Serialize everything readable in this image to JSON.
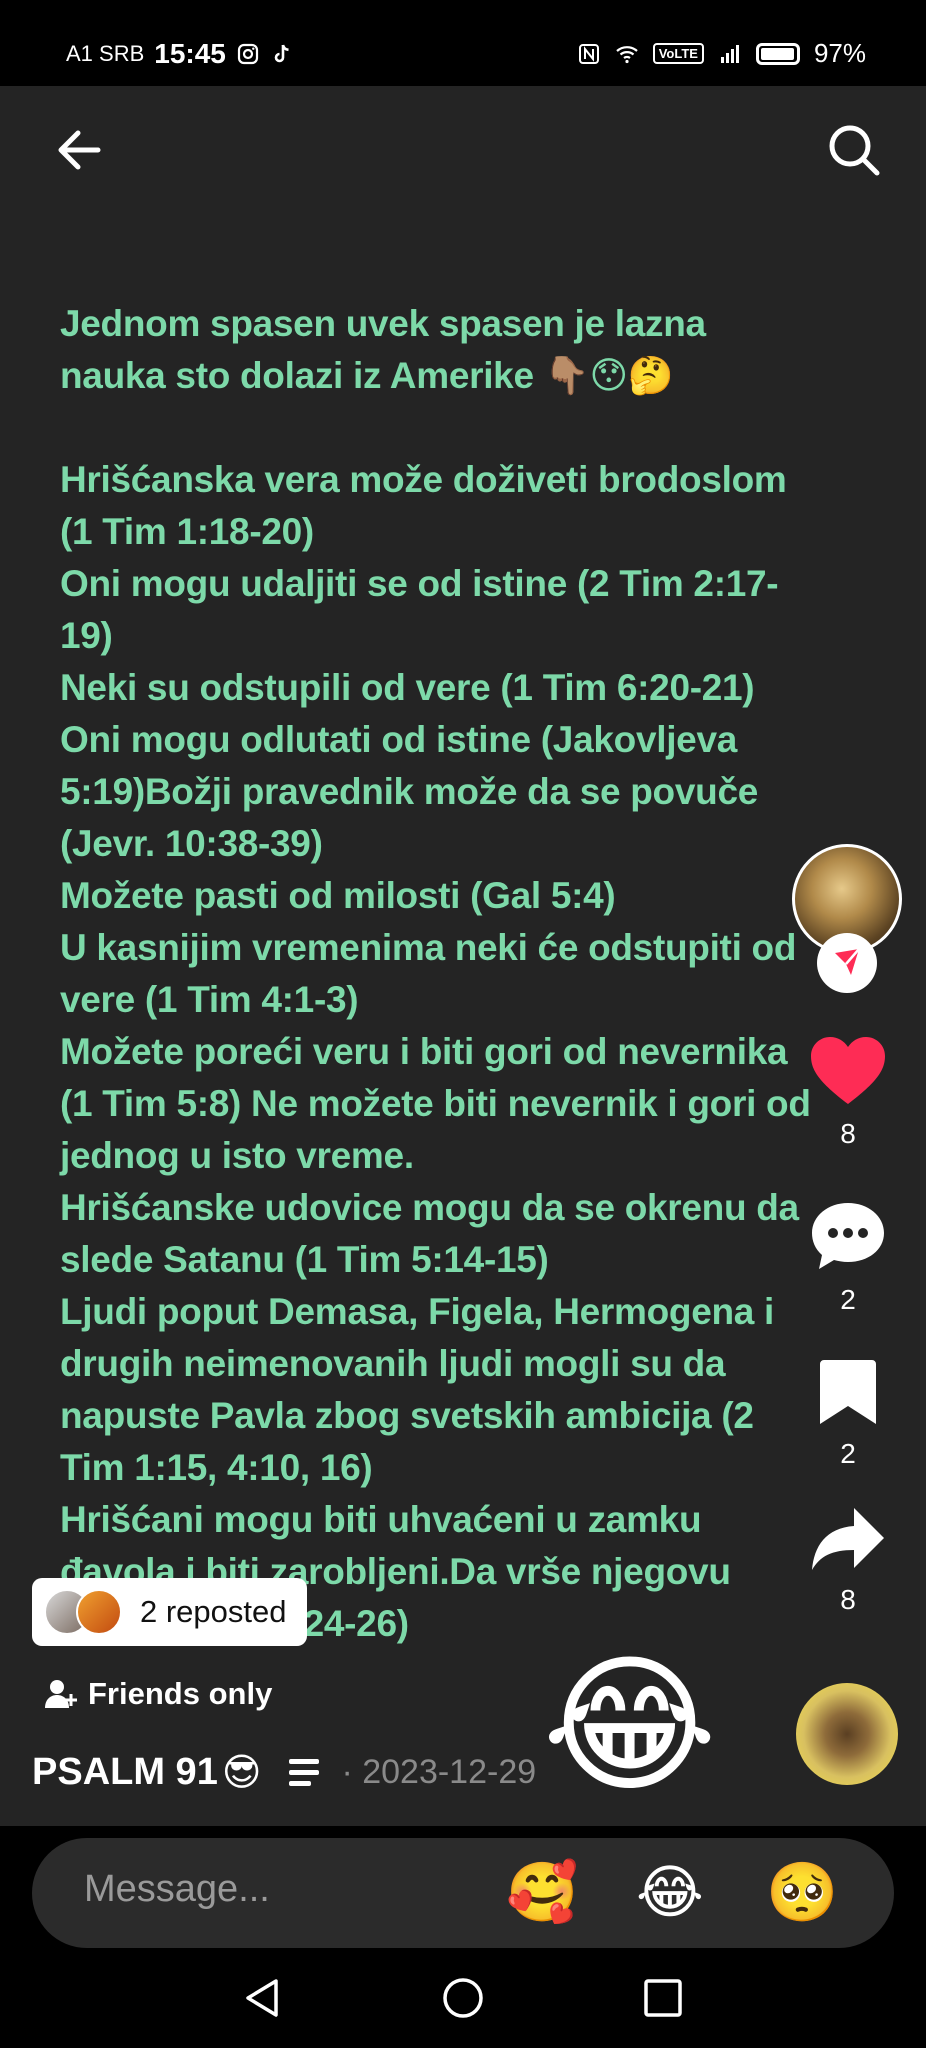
{
  "status_bar": {
    "carrier": "A1 SRB",
    "time": "15:45",
    "network": "VoLTE",
    "battery": "97%"
  },
  "caption": {
    "lines": [
      "Jednom spasen uvek spasen je lazna nauka sto dolazi iz Amerike 👇🏽😯🤔",
      "",
      "Hrišćanska vera može doživeti brodoslom (1 Tim 1:18-20)",
      "Oni mogu udaljiti se od istine (2 Tim 2:17-19)",
      "Neki su odstupili od vere (1 Tim 6:20-21)",
      "Oni mogu odlutati od istine (Jakovljeva 5:19)Božji pravednik može da se povuče (Jevr. 10:38-39)",
      "Možete pasti od milosti (Gal 5:4)",
      "U kasnijim vremenima neki će odstupiti od vere (1 Tim 4:1-3)",
      "Možete poreći veru i biti gori od nevernika (1 Tim 5:8) Ne možete biti nevernik i gori od jednog u isto vreme.",
      "Hrišćanske udovice mogu da se okrenu da slede Satanu (1 Tim 5:14-15)",
      "Ljudi poput Demasa, Figela, Hermogena i drugih neimenovanih ljudi mogli su da napuste Pavla zbog svetskih ambicija (2 Tim 1:15, 4:10, 16)",
      "Hrišćani mogu biti uhvaćeni u zamku đavola i biti zarobljeni.Da vrše njegovu volju (2 Tim 2:24-26)"
    ]
  },
  "actions": {
    "likes": "8",
    "comments": "2",
    "bookmarks": "2",
    "shares": "8"
  },
  "reposted": {
    "label": "2 reposted"
  },
  "privacy": {
    "label": "Friends only"
  },
  "author": {
    "name": "PSALM 91",
    "emoji": "😎",
    "date": "· 2023-12-29"
  },
  "overlay_emoji": "😂",
  "message_bar": {
    "placeholder": "Message...",
    "quick_emojis": [
      "🥰",
      "😂",
      "🥺"
    ]
  },
  "colors": {
    "caption_text": "#7dd9a9",
    "like_heart": "#fe2c55",
    "follow_badge": "#fe2c55",
    "background": "#242424"
  }
}
